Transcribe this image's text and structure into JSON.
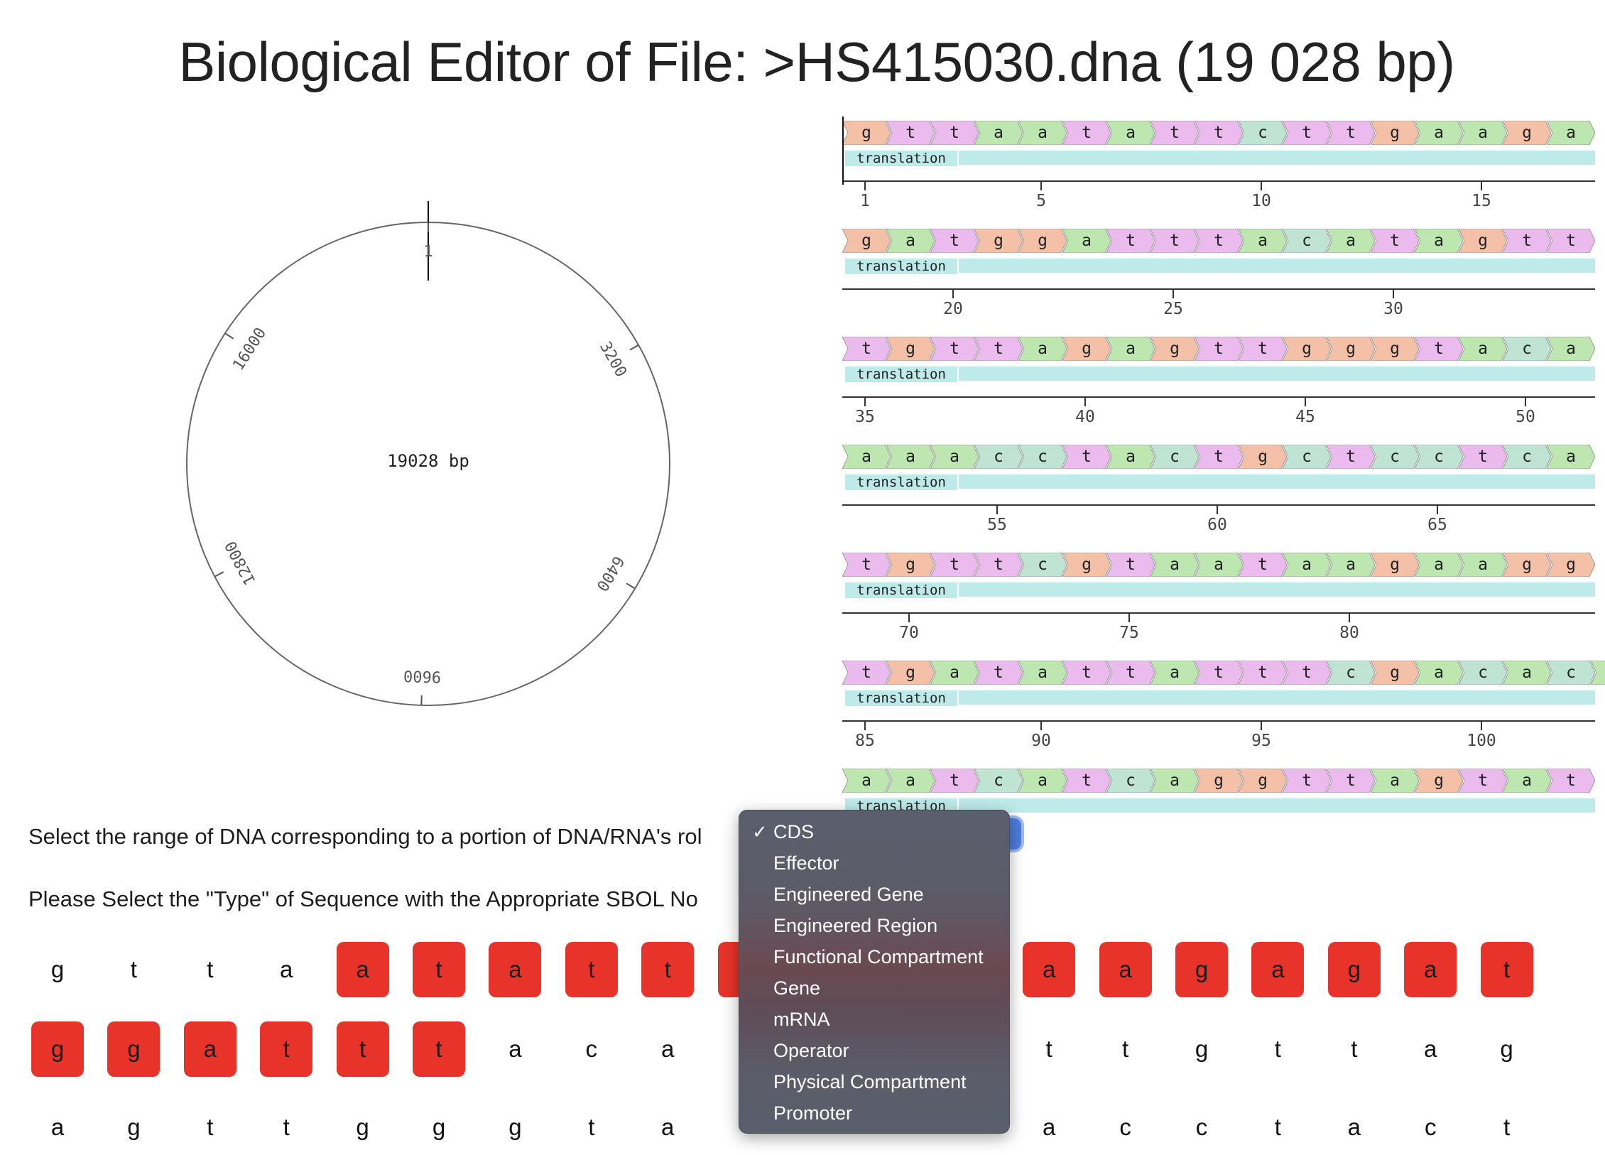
{
  "title": "Biological Editor of File: >HS415030.dna (19 028 bp)",
  "circular_map": {
    "center_label": "19028 bp",
    "ticks": [
      "1",
      "3200",
      "6400",
      "9600",
      "12800",
      "16000"
    ]
  },
  "linear_map": {
    "feature_label": "translation",
    "colors": {
      "a": "#bde6b0",
      "t": "#ebbbed",
      "g": "#f4c0a8",
      "c": "#bfe4d3",
      "feature": "#bfeaea"
    },
    "rows": [
      {
        "bases": "gttaatattcttgaaga",
        "ticks": [
          {
            "label": "1",
            "pos": 0
          },
          {
            "label": "5",
            "pos": 4
          },
          {
            "label": "10",
            "pos": 9
          },
          {
            "label": "15",
            "pos": 14
          }
        ]
      },
      {
        "bases": "gatggatttacatagtt",
        "ticks": [
          {
            "label": "20",
            "pos": 2
          },
          {
            "label": "25",
            "pos": 7
          },
          {
            "label": "30",
            "pos": 12
          }
        ]
      },
      {
        "bases": "tgttagagttgggtaca",
        "ticks": [
          {
            "label": "35",
            "pos": 0
          },
          {
            "label": "40",
            "pos": 5
          },
          {
            "label": "45",
            "pos": 10
          },
          {
            "label": "50",
            "pos": 15
          }
        ]
      },
      {
        "bases": "aaacctactgctcctca",
        "ticks": [
          {
            "label": "55",
            "pos": 3
          },
          {
            "label": "60",
            "pos": 8
          },
          {
            "label": "65",
            "pos": 13
          }
        ]
      },
      {
        "bases": "tgttcgtaataagaagg",
        "ticks": [
          {
            "label": "70",
            "pos": 1
          },
          {
            "label": "75",
            "pos": 6
          },
          {
            "label": "80",
            "pos": 11
          }
        ]
      },
      {
        "bases": "tgatattatttcgacaca",
        "ticks": [
          {
            "label": "85",
            "pos": 0
          },
          {
            "label": "90",
            "pos": 4
          },
          {
            "label": "95",
            "pos": 9
          },
          {
            "label": "100",
            "pos": 14
          }
        ]
      },
      {
        "bases": "aatcatcaggttagtat",
        "ticks": []
      }
    ]
  },
  "instructions": {
    "range_prompt": "Select the range of DNA corresponding to a portion of DNA/RNA's rol",
    "type_prompt": "Please Select the \"Type\" of Sequence with the Appropriate SBOL No"
  },
  "sequence_grid": {
    "rows": [
      {
        "cells": [
          {
            "b": "g",
            "sel": false
          },
          {
            "b": "t",
            "sel": false
          },
          {
            "b": "t",
            "sel": false
          },
          {
            "b": "a",
            "sel": false
          },
          {
            "b": "a",
            "sel": true
          },
          {
            "b": "t",
            "sel": true
          },
          {
            "b": "a",
            "sel": true
          },
          {
            "b": "t",
            "sel": true
          },
          {
            "b": "t",
            "sel": true
          },
          {
            "b": "",
            "sel": true
          },
          {
            "b": "",
            "sel": false
          },
          {
            "b": "",
            "sel": false
          },
          {
            "b": "",
            "sel": false
          },
          {
            "b": "a",
            "sel": true
          },
          {
            "b": "a",
            "sel": true
          },
          {
            "b": "g",
            "sel": true
          },
          {
            "b": "a",
            "sel": true
          },
          {
            "b": "g",
            "sel": true
          },
          {
            "b": "a",
            "sel": true
          },
          {
            "b": "t",
            "sel": true
          }
        ]
      },
      {
        "cells": [
          {
            "b": "g",
            "sel": true
          },
          {
            "b": "g",
            "sel": true
          },
          {
            "b": "a",
            "sel": true
          },
          {
            "b": "t",
            "sel": true
          },
          {
            "b": "t",
            "sel": true
          },
          {
            "b": "t",
            "sel": true
          },
          {
            "b": "a",
            "sel": false
          },
          {
            "b": "c",
            "sel": false
          },
          {
            "b": "a",
            "sel": false
          },
          {
            "b": "",
            "sel": false
          },
          {
            "b": "",
            "sel": false
          },
          {
            "b": "",
            "sel": false
          },
          {
            "b": "",
            "sel": false
          },
          {
            "b": "t",
            "sel": false
          },
          {
            "b": "t",
            "sel": false
          },
          {
            "b": "g",
            "sel": false
          },
          {
            "b": "t",
            "sel": false
          },
          {
            "b": "t",
            "sel": false
          },
          {
            "b": "a",
            "sel": false
          },
          {
            "b": "g",
            "sel": false
          }
        ]
      },
      {
        "cells": [
          {
            "b": "a",
            "sel": false
          },
          {
            "b": "g",
            "sel": false
          },
          {
            "b": "t",
            "sel": false
          },
          {
            "b": "t",
            "sel": false
          },
          {
            "b": "g",
            "sel": false
          },
          {
            "b": "g",
            "sel": false
          },
          {
            "b": "g",
            "sel": false
          },
          {
            "b": "t",
            "sel": false
          },
          {
            "b": "a",
            "sel": false
          },
          {
            "b": "",
            "sel": false
          },
          {
            "b": "",
            "sel": false
          },
          {
            "b": "",
            "sel": false
          },
          {
            "b": "",
            "sel": false
          },
          {
            "b": "a",
            "sel": false
          },
          {
            "b": "c",
            "sel": false
          },
          {
            "b": "c",
            "sel": false
          },
          {
            "b": "t",
            "sel": false
          },
          {
            "b": "a",
            "sel": false
          },
          {
            "b": "c",
            "sel": false
          },
          {
            "b": "t",
            "sel": false
          }
        ]
      }
    ]
  },
  "dropdown": {
    "selected": "CDS",
    "options": [
      "CDS",
      "Effector",
      "Engineered Gene",
      "Engineered Region",
      "Functional Compartment",
      "Gene",
      "mRNA",
      "Operator",
      "Physical Compartment",
      "Promoter"
    ]
  }
}
